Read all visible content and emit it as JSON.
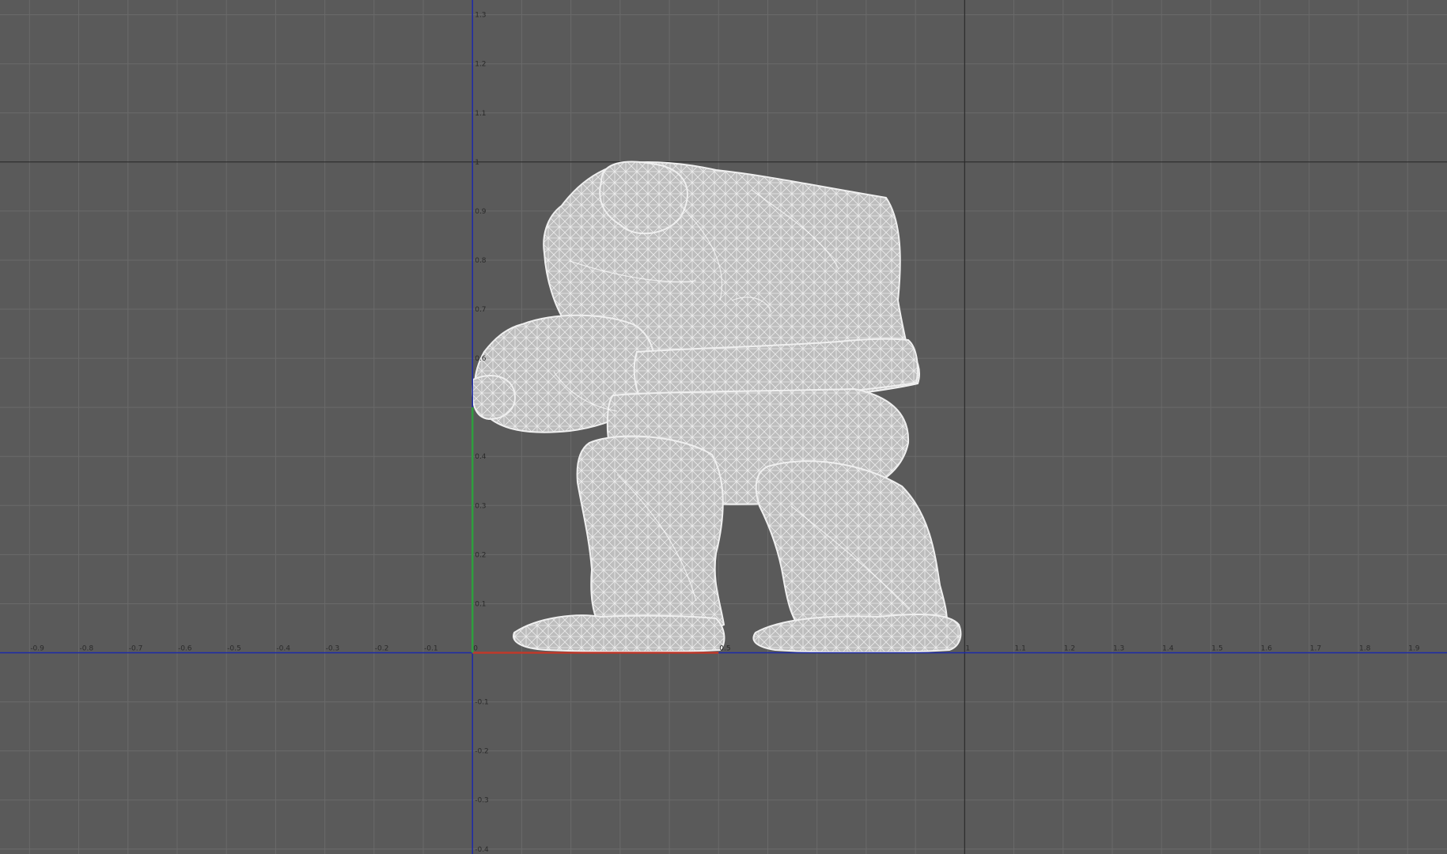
{
  "viewport": {
    "view": "front orthographic",
    "display_mode": "wireframe",
    "colors": {
      "background": "#5a5a5a",
      "grid_minor": "#6a6a6a",
      "grid_major": "#2b2b2b",
      "axis_horizontal": "#1d2aa8",
      "axis_vertical": "#1d2aa8",
      "axis_x_positive": "#c0392b",
      "axis_y_positive": "#2e9e3e",
      "wireframe": "#e6e6e6",
      "tick_label": "#2a2a2a"
    },
    "x_axis": {
      "range": [
        -0.96,
        1.98
      ],
      "ticks": [
        {
          "v": -0.9,
          "label": "-0.9"
        },
        {
          "v": -0.8,
          "label": "-0.8"
        },
        {
          "v": -0.7,
          "label": "-0.7"
        },
        {
          "v": -0.6,
          "label": "-0.6"
        },
        {
          "v": -0.5,
          "label": "-0.5"
        },
        {
          "v": -0.4,
          "label": "-0.4"
        },
        {
          "v": -0.3,
          "label": "-0.3"
        },
        {
          "v": -0.2,
          "label": "-0.2"
        },
        {
          "v": -0.1,
          "label": "-0.1"
        },
        {
          "v": 0,
          "label": "0"
        },
        {
          "v": 0.5,
          "label": "0.5"
        },
        {
          "v": 1,
          "label": "1"
        },
        {
          "v": 1.1,
          "label": "1.1"
        },
        {
          "v": 1.2,
          "label": "1.2"
        },
        {
          "v": 1.3,
          "label": "1.3"
        },
        {
          "v": 1.4,
          "label": "1.4"
        },
        {
          "v": 1.5,
          "label": "1.5"
        },
        {
          "v": 1.6,
          "label": "1.6"
        },
        {
          "v": 1.7,
          "label": "1.7"
        },
        {
          "v": 1.8,
          "label": "1.8"
        },
        {
          "v": 1.9,
          "label": "1.9"
        }
      ]
    },
    "y_axis": {
      "range": [
        -0.41,
        1.33
      ],
      "ticks": [
        {
          "v": 1.3,
          "label": "1.3"
        },
        {
          "v": 1.2,
          "label": "1.2"
        },
        {
          "v": 1.1,
          "label": "1.1"
        },
        {
          "v": 1,
          "label": "1"
        },
        {
          "v": 0.9,
          "label": "0.9"
        },
        {
          "v": 0.8,
          "label": "0.8"
        },
        {
          "v": 0.7,
          "label": "0.7"
        },
        {
          "v": 0.6,
          "label": "0.6"
        },
        {
          "v": 0.4,
          "label": "0.4"
        },
        {
          "v": 0.3,
          "label": "0.3"
        },
        {
          "v": 0.2,
          "label": "0.2"
        },
        {
          "v": 0.1,
          "label": "0.1"
        },
        {
          "v": -0.1,
          "label": "-0.1"
        },
        {
          "v": -0.2,
          "label": "-0.2"
        },
        {
          "v": -0.3,
          "label": "-0.3"
        },
        {
          "v": -0.4,
          "label": "-0.4"
        }
      ]
    },
    "grid": {
      "minor_step": 0.1,
      "major_step": 1
    },
    "model": {
      "name": "rock-golem-mesh"
    }
  }
}
